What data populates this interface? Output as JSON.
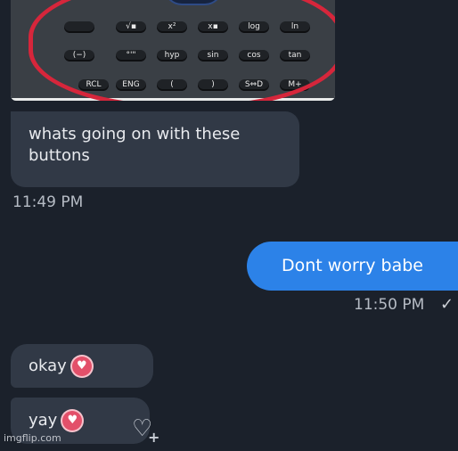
{
  "calculator": {
    "rows": [
      [
        "",
        "√▪",
        "x²",
        "x▪",
        "log",
        "ln"
      ],
      [
        "(−)",
        "°'\"",
        "hyp",
        "sin",
        "cos",
        "tan"
      ],
      [
        "RCL",
        "ENG",
        "(",
        ")",
        "S⇔D",
        "M+"
      ]
    ]
  },
  "messages": [
    {
      "side": "in",
      "text": "whats going on with these buttons"
    },
    {
      "side": "out",
      "text": "Dont worry babe"
    },
    {
      "side": "in",
      "text": "okay"
    },
    {
      "side": "in",
      "text": "yay"
    }
  ],
  "timestamps": {
    "first": "11:49 PM",
    "second": "11:50 PM"
  },
  "colors": {
    "background": "#1b212b",
    "incoming": "#313946",
    "outgoing": "#2c82e8",
    "heart": "#e3506a",
    "circle": "#d6263b"
  },
  "icons": {
    "heart": "heart-icon",
    "add_reaction": "add-reaction-icon",
    "delivered": "checkmark-icon"
  },
  "watermark": "imgflip.com"
}
